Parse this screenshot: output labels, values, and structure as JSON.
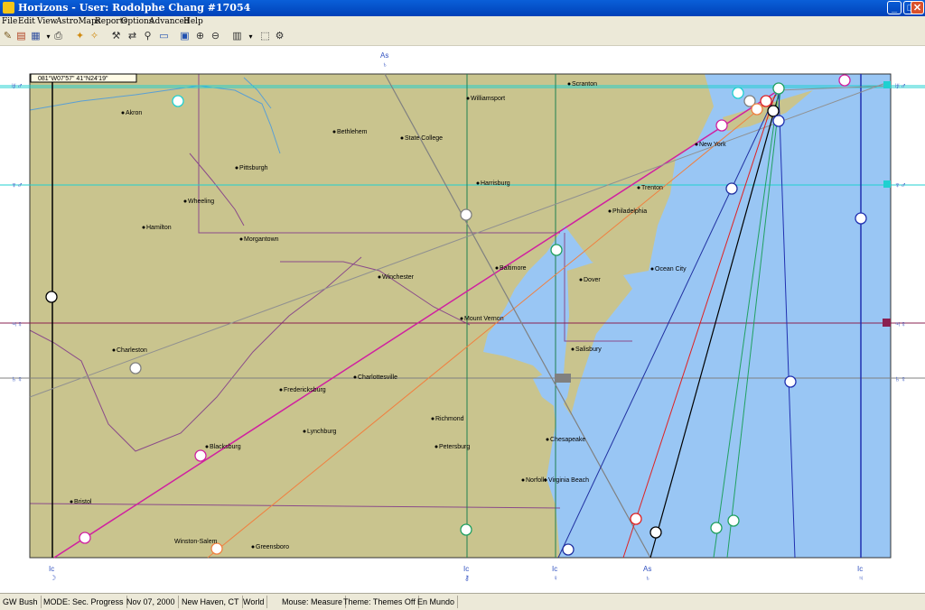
{
  "window": {
    "title": "Horizons - User: Rodolphe Chang #17054",
    "minimize": "_",
    "maximize": "□",
    "close": "✕"
  },
  "menu": [
    "File",
    "Edit",
    "View",
    "AstroMaps",
    "Reports",
    "Options",
    "Advanced",
    "Help"
  ],
  "coords": "081°W07'57\"    41°N24'19\"",
  "cities": [
    {
      "name": "Scranton"
    },
    {
      "name": "Williamsport"
    },
    {
      "name": "Akron"
    },
    {
      "name": "Bethlehem"
    },
    {
      "name": "State College"
    },
    {
      "name": "New York"
    },
    {
      "name": "Pittsburgh"
    },
    {
      "name": "Harrisburg"
    },
    {
      "name": "Trenton"
    },
    {
      "name": "Wheeling"
    },
    {
      "name": "Philadelphia"
    },
    {
      "name": "Hamilton"
    },
    {
      "name": "Morgantown"
    },
    {
      "name": "Baltimore"
    },
    {
      "name": "Ocean City"
    },
    {
      "name": "Winchester"
    },
    {
      "name": "Dover"
    },
    {
      "name": "Mount Vernon"
    },
    {
      "name": "Charleston"
    },
    {
      "name": "Salisbury"
    },
    {
      "name": "Charlottesville"
    },
    {
      "name": "Fredericksburg"
    },
    {
      "name": "Richmond"
    },
    {
      "name": "Lynchburg"
    },
    {
      "name": "Chesapeake"
    },
    {
      "name": "Blacksburg"
    },
    {
      "name": "Petersburg"
    },
    {
      "name": "Norfolk"
    },
    {
      "name": "Virginia Beach"
    },
    {
      "name": "Bristol"
    },
    {
      "name": "Winston-Salem"
    },
    {
      "name": "Greensboro"
    }
  ],
  "angle_labels": {
    "as_top": "As",
    "as_bottom": "As",
    "ic": "Ic"
  },
  "status": {
    "person": "GW Bush",
    "mode": "MODE: Sec. Progress",
    "date": "Nov 07, 2000",
    "place": "New Haven, CT",
    "map": "World",
    "mouse": "Mouse: Measure",
    "theme": "Theme: Themes Off",
    "mundo": "En Mundo"
  },
  "colors": {
    "land": "#c9c48e",
    "water": "#99c6f4",
    "titlebar": "#0a5fd8"
  }
}
